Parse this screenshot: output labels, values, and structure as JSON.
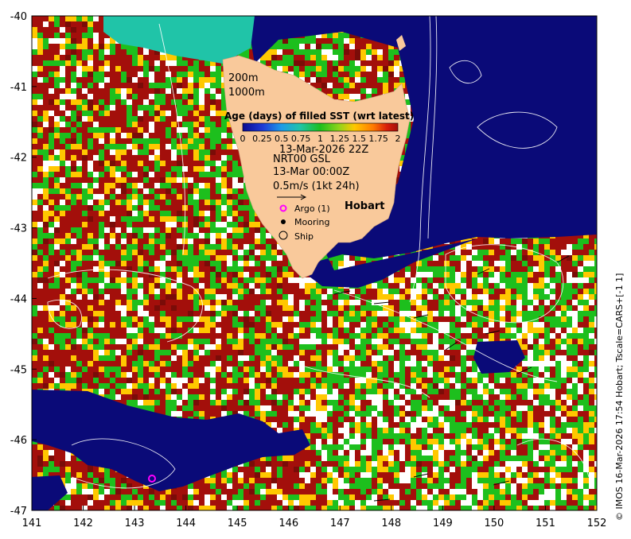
{
  "map": {
    "lon_range": [
      141,
      152
    ],
    "lat_range": [
      -47,
      -40
    ],
    "x_ticks": [
      "141",
      "142",
      "143",
      "144",
      "145",
      "146",
      "147",
      "148",
      "149",
      "150",
      "151",
      "152"
    ],
    "y_ticks": [
      "-40",
      "-41",
      "-42",
      "-43",
      "-44",
      "-45",
      "-46",
      "-47"
    ],
    "isobath_labels": [
      "200m",
      "1000m"
    ],
    "place_label": "Hobart",
    "colors": {
      "land": "#f9c99b",
      "age_0": "#0a0a78",
      "age_green": "#1dbf1d",
      "age_red": "#a30f0b",
      "age_yellow": "#ffc800",
      "teal": "#20c4a8",
      "no_data": "#ffffff",
      "contour": "#ffffff",
      "argo": "#ff00ff"
    }
  },
  "colorbar": {
    "title": "Age (days) of filled SST (wrt latest)",
    "tick_labels": [
      "0",
      "0.25",
      "0.5",
      "0.75",
      "1",
      "1.25",
      "1.5",
      "1.75",
      "2"
    ],
    "range": [
      0,
      2
    ]
  },
  "legend": {
    "date_line": "13-Mar-2026 22Z",
    "product_line": "NRT00 GSL",
    "time_line": "13-Mar 00:00Z",
    "scale_line": "0.5m/s (1kt 24h)",
    "argo_label": "Argo (1)",
    "mooring_label": "Mooring",
    "ship_label": "Ship"
  },
  "credit": "© IMOS 16-Mar-2026 17:54 Hobart; Tscale=CARS+[-1 1]"
}
